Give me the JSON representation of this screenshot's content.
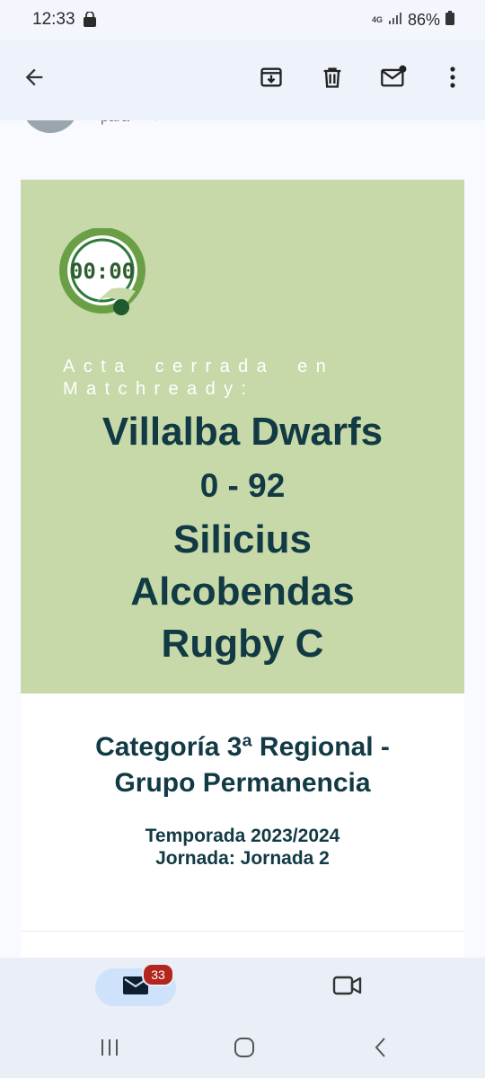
{
  "status_bar": {
    "time": "12:33",
    "network": "4G",
    "battery": "86%"
  },
  "toolbar": {
    "back_icon": "arrow-left-icon",
    "archive_icon": "archive-icon",
    "delete_icon": "trash-icon",
    "unread_icon": "mark-unread-icon",
    "more_icon": "more-vert-icon"
  },
  "sender": {
    "to_label": "para"
  },
  "email": {
    "logo_text": "00:00",
    "closed_label": "Acta cerrada en Matchready:",
    "home_team": "Villalba Dwarfs",
    "score": "0 - 92",
    "away_team_line1": "Silicius",
    "away_team_line2": "Alcobendas",
    "away_team_line3": "Rugby C",
    "category_line1": "Categoría 3ª Regional -",
    "category_line2": "Grupo Permanencia",
    "season": "Temporada 2023/2024",
    "round": "Jornada: Jornada 2"
  },
  "bottom_nav": {
    "mail_badge": "33"
  },
  "colors": {
    "green_bg": "#c7d9a8",
    "text_dark": "#123a44",
    "badge": "#b3261e"
  }
}
